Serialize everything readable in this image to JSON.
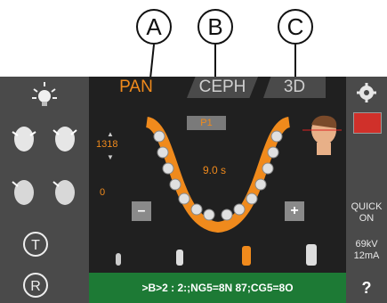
{
  "callouts": [
    "A",
    "B",
    "C"
  ],
  "tabs": [
    {
      "label": "PAN",
      "active": true
    },
    {
      "label": "CEPH",
      "active": false
    },
    {
      "label": "3D",
      "active": false
    }
  ],
  "program_label": "P1",
  "height_value": "1318",
  "zero_value": "0",
  "exposure_time": "9.0 s",
  "minus_label": "–",
  "plus_label": "+",
  "quick_on": [
    "QUICK",
    "ON"
  ],
  "kv": "69kV",
  "ma": "12mA",
  "help_label": "?",
  "status_text": ">B>2 : 2:;NG5=8N 87;CG5=8O",
  "icons": {
    "left_panel": [
      "light-icon",
      "patient-head-front-icon",
      "patient-head-side-icon",
      "patient-head-back-icon",
      "patient-head-tilt-icon",
      "t-rotate-icon",
      "r-return-icon"
    ],
    "right_panel": [
      "gear-icon",
      "dental-chart-icon"
    ]
  },
  "colors": {
    "accent": "#f08a1c",
    "status_bg": "#1d7a35"
  }
}
